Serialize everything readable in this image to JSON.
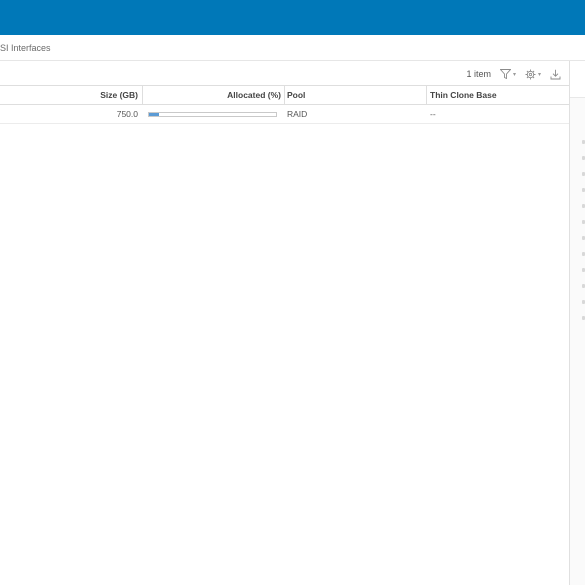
{
  "breadcrumb": {
    "text": "SI Interfaces"
  },
  "toolbar": {
    "item_count": "1 item",
    "filter_icon": "filter-icon",
    "settings_icon": "gear-icon",
    "export_icon": "download-icon"
  },
  "table": {
    "columns": {
      "size": "Size (GB)",
      "allocated": "Allocated (%)",
      "pool": "Pool",
      "thin_clone_base": "Thin Clone Base"
    },
    "rows": [
      {
        "size": "750.0",
        "allocated_fraction": 0.08,
        "pool": "RAID",
        "thin_clone_base": "--"
      }
    ]
  },
  "colors": {
    "topbar": "#0078b8",
    "progress_fill": "#5b9bd5"
  }
}
